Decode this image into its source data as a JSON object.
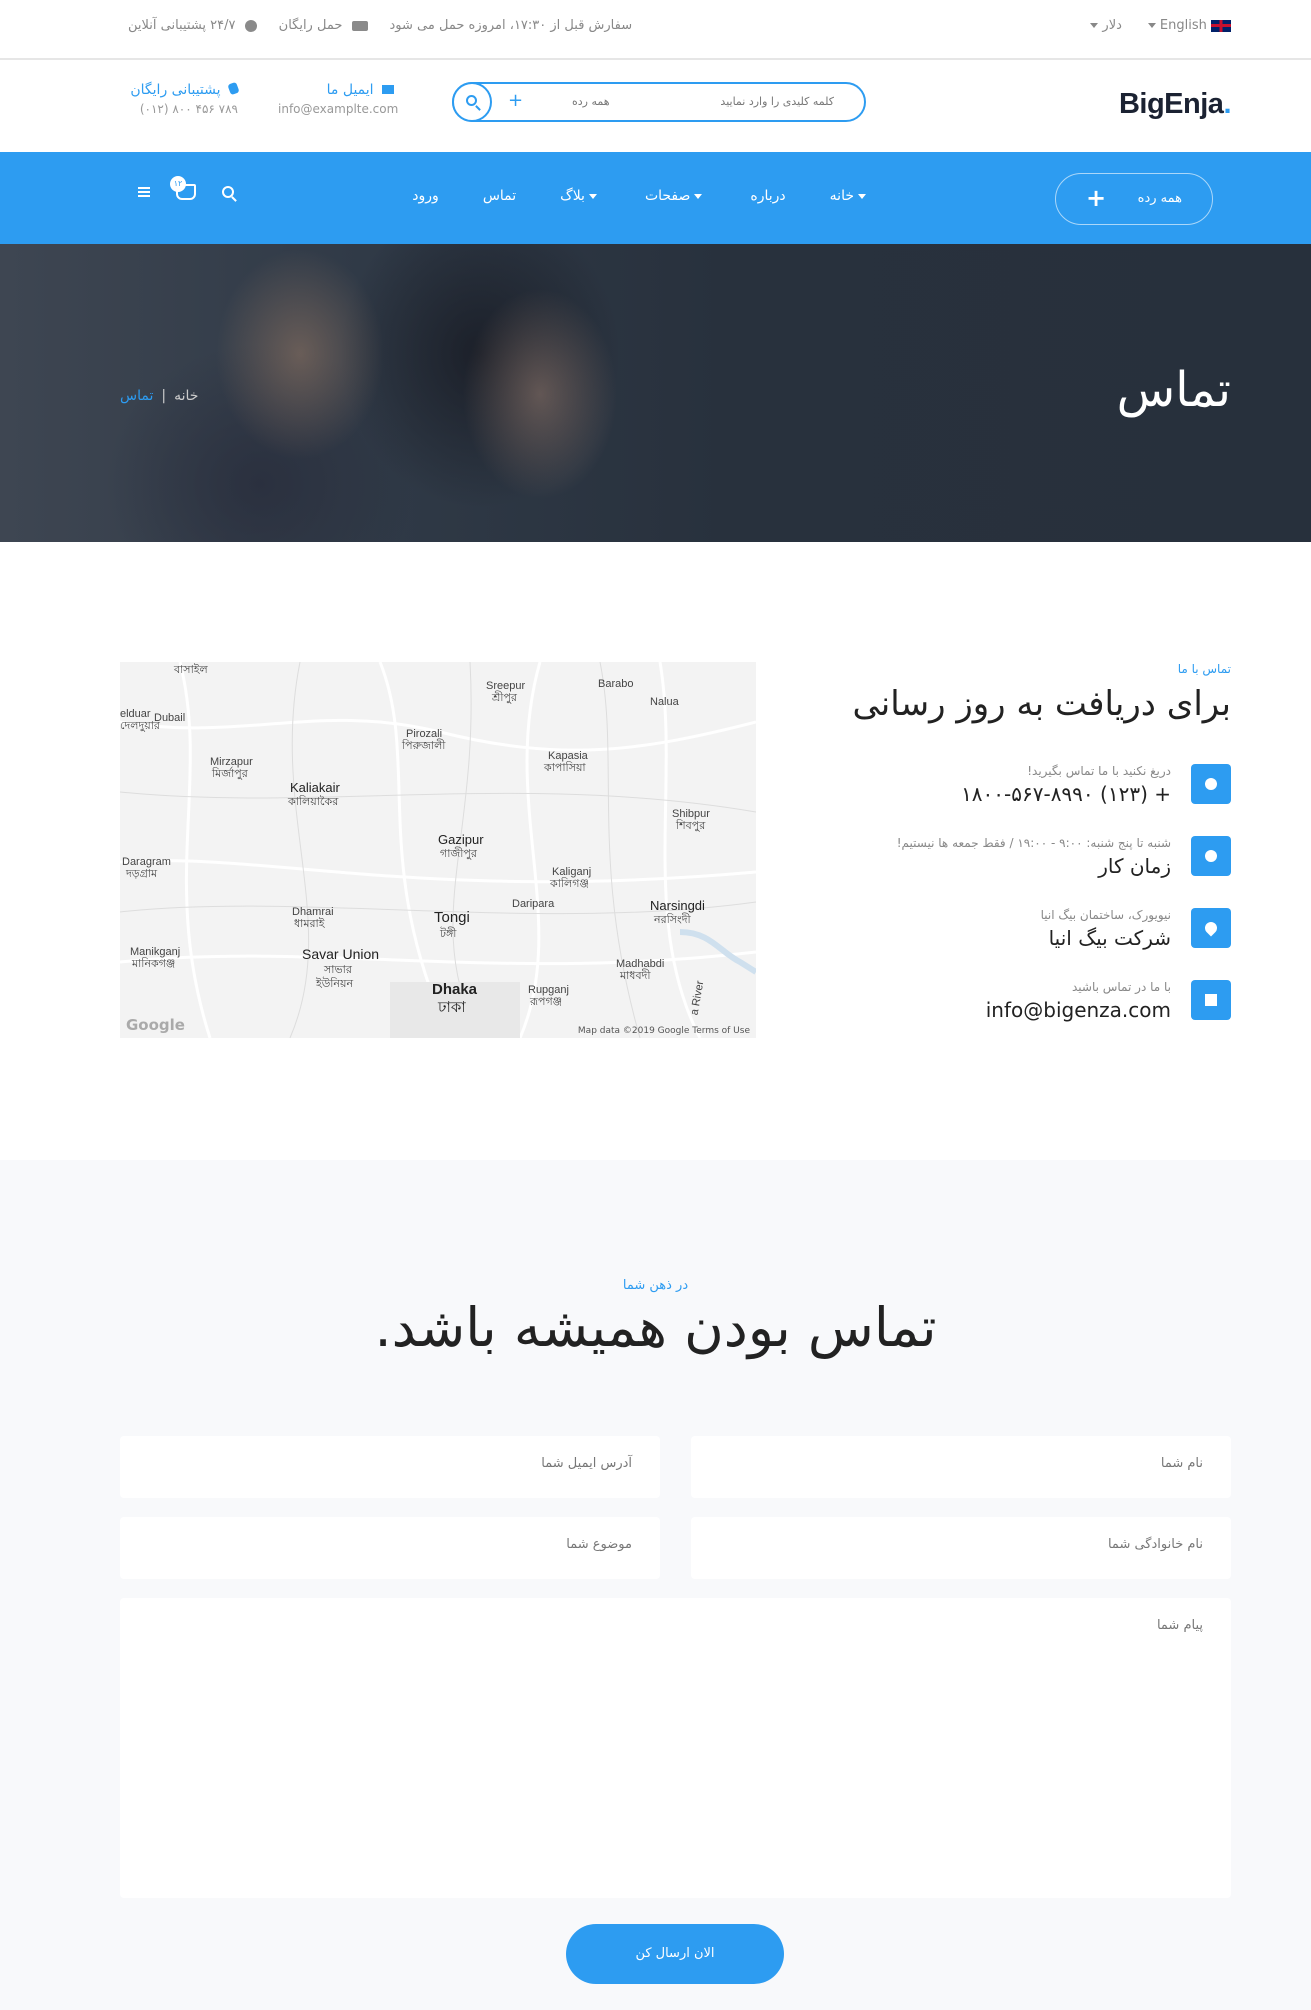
{
  "topbar": {
    "language": "English",
    "currency": "دلار",
    "order_notice": "سفارش قبل از ۱۷:۳۰، امروزه حمل می شود",
    "free_shipping": "حمل رایگان",
    "support": "۲۴/۷ پشتیبانی آنلاین"
  },
  "header": {
    "logo": "BigEnja",
    "logo_dot": ".",
    "search_placeholder": "کلمه کلیدی را وارد نمایید",
    "search_category": "همه رده",
    "search_plus": "+",
    "email_title": "ایمیل ما",
    "email_value": "info@examplte.com",
    "phone_title": "پشتیبانی رایگان",
    "phone_value": "(۰۱۲) ۸۰۰ ۴۵۶ ۷۸۹"
  },
  "nav": {
    "category_button": "همه رده",
    "category_plus": "+",
    "items": [
      "خانه",
      "درباره",
      "صفحات",
      "بلاگ",
      "تماس",
      "ورود"
    ],
    "cart_count": "۱۲"
  },
  "hero": {
    "title": "تماس",
    "breadcrumb_home": "خانه",
    "breadcrumb_sep": "|",
    "breadcrumb_current": "تماس"
  },
  "contact": {
    "pre": "تماس با ما",
    "title": "برای دریافت به روز رسانی",
    "items": [
      {
        "icon": "phone-icon",
        "small": "دریغ نکنید با ما تماس بگیرید!",
        "value": "+ (۱۲۳) ۱۸۰۰-۵۶۷-۸۹۹۰"
      },
      {
        "icon": "clock-icon",
        "small": "شنبه تا پنج شنبه: ۹:۰۰ - ۱۹:۰۰ / فقط جمعه ها نیستیم!",
        "value": "زمان کار"
      },
      {
        "icon": "location-pin-icon",
        "small": "نیویورک، ساختمان بیگ انیا",
        "value": "شرکت بیگ انیا"
      },
      {
        "icon": "envelope-icon",
        "small": "با ما در تماس باشید",
        "value": "info@bigenza.com"
      }
    ]
  },
  "map": {
    "labels": [
      "বাসাইল",
      "Sreepur",
      "শ্রীপুর",
      "Barabo",
      "Nalua",
      "elduar",
      "দেলদুয়ার",
      "Dubail",
      "Pirozali",
      "পিরুজালী",
      "Kapasia",
      "কাপাসিয়া",
      "Mirzapur",
      "মির্জাপুর",
      "Kaliakair",
      "কালিয়াকৈর",
      "Shibpur",
      "শিবপুর",
      "Gazipur",
      "গাজীপুর",
      "Daragram",
      "দড়গ্রাম",
      "Kaliganj",
      "কালিগঞ্জ",
      "Daripara",
      "Narsingdi",
      "নরসিংদী",
      "Dhamrai",
      "ধামরাই",
      "Tongi",
      "টঙ্গী",
      "Manikganj",
      "মানিকগঞ্জ",
      "Savar Union",
      "সাভার",
      "ইউনিয়ন",
      "Madhabdi",
      "মাধবদী",
      "Dhaka",
      "ঢাকা",
      "Rupganj",
      "রূপগঞ্জ",
      "a River"
    ],
    "google": "Google",
    "attribution": "Map data ©2019 Google   Terms of Use"
  },
  "form": {
    "pre": "در ذهن شما",
    "title": "تماس بودن همیشه باشد.",
    "name_placeholder": "نام شما",
    "email_placeholder": "آدرس ایمیل شما",
    "family_placeholder": "نام خانوادگی شما",
    "subject_placeholder": "موضوع شما",
    "message_placeholder": "پیام شما",
    "submit": "الان ارسال کن"
  },
  "colors": {
    "accent": "#2d9cf1",
    "dark": "#1b2232",
    "hero_bg": "#28313d",
    "form_bg": "#f8f9fb"
  }
}
